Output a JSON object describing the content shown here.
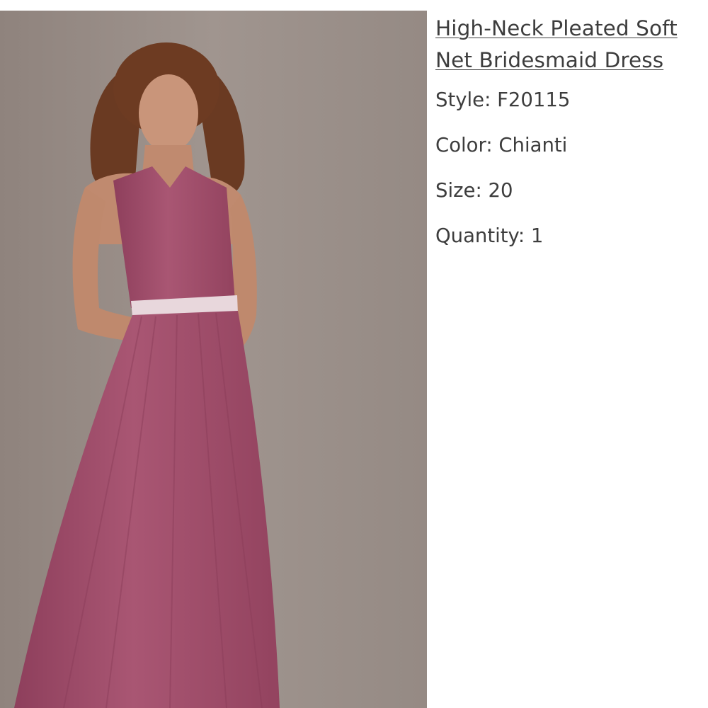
{
  "product": {
    "title_line1": "High-Neck Pleated Soft",
    "title_line2": "Net Bridesmaid Dress",
    "image_alt": "Model wearing Chianti high-neck pleated bridesmaid dress"
  },
  "specs": {
    "style_label": "Style:",
    "style_value": "F20115",
    "color_label": "Color:",
    "color_value": "Chianti",
    "size_label": "Size:",
    "size_value": "20",
    "quantity_label": "Quantity:",
    "quantity_value": "1"
  },
  "colors": {
    "dress": "#a5506f",
    "backdrop": "#9a8f89",
    "text": "#3d3d3d"
  }
}
